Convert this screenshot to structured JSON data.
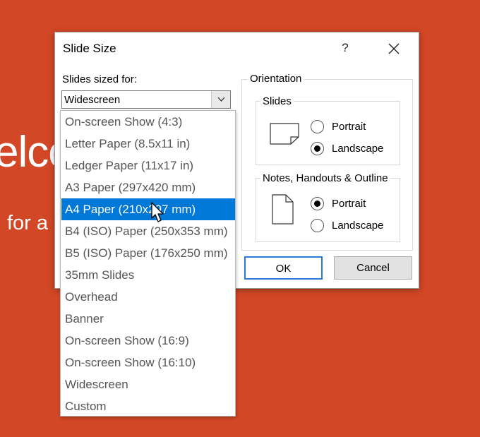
{
  "background": {
    "title_fragment": "elco",
    "subtitle_fragment": "for a",
    "color": "#d24726"
  },
  "dialog": {
    "title": "Slide Size",
    "help_label": "?",
    "close_icon": "close-icon"
  },
  "slides_sized_for": {
    "label": "Slides sized for:",
    "value": "Widescreen",
    "arrow_icon": "chevron-down-icon"
  },
  "dropdown": {
    "selected_index": 4,
    "items": [
      "On-screen Show (4:3)",
      "Letter Paper (8.5x11 in)",
      "Ledger Paper (11x17 in)",
      "A3 Paper (297x420 mm)",
      "A4 Paper (210x297 mm)",
      "B4 (ISO) Paper (250x353 mm)",
      "B5 (ISO) Paper (176x250 mm)",
      "35mm Slides",
      "Overhead",
      "Banner",
      "On-screen Show (16:9)",
      "On-screen Show (16:10)",
      "Widescreen",
      "Custom"
    ],
    "accent": "#0078d7"
  },
  "orientation": {
    "legend": "Orientation",
    "slides": {
      "legend": "Slides",
      "icon": "landscape-page-icon",
      "portrait_label": "Portrait",
      "landscape_label": "Landscape",
      "selected": "landscape"
    },
    "notes": {
      "legend": "Notes, Handouts & Outline",
      "icon": "portrait-page-icon",
      "portrait_label": "Portrait",
      "landscape_label": "Landscape",
      "selected": "portrait"
    }
  },
  "buttons": {
    "ok": "OK",
    "cancel": "Cancel"
  },
  "cursor_icon": "mouse-pointer-icon"
}
